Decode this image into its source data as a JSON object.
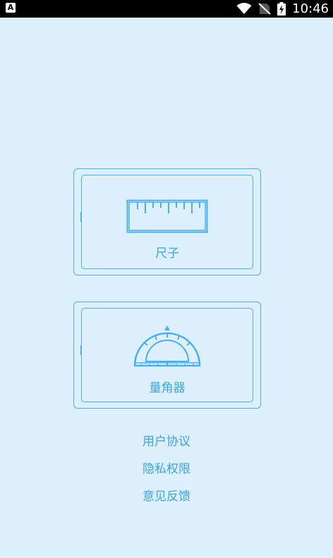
{
  "status_bar": {
    "time": "10:46",
    "left_icon": "A",
    "icons": [
      "wifi-icon",
      "no-sim-icon",
      "battery-charging-icon"
    ]
  },
  "tools": [
    {
      "label": "尺子",
      "icon": "ruler-icon"
    },
    {
      "label": "量角器",
      "icon": "protractor-icon"
    }
  ],
  "links": [
    {
      "label": "用户协议"
    },
    {
      "label": "隐私权限"
    },
    {
      "label": "意见反馈"
    }
  ],
  "colors": {
    "background": "#ddeefc",
    "accent": "#4ab0ea",
    "text": "#3aa6e4",
    "status_bar": "#000000"
  }
}
